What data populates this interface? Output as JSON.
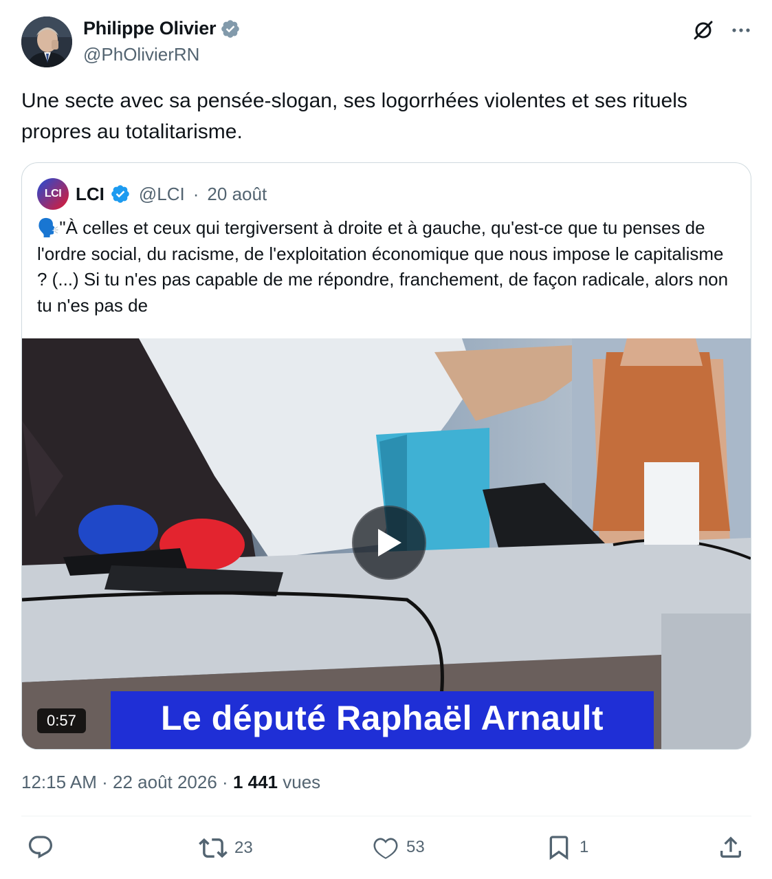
{
  "author": {
    "display_name": "Philippe Olivier",
    "handle": "@PhOlivierRN",
    "verified": true
  },
  "icons": {
    "grok": "grok-icon",
    "more": "more-icon",
    "verified": "verified-badge-icon",
    "reply": "reply-icon",
    "retweet": "retweet-icon",
    "like": "heart-icon",
    "bookmark": "bookmark-icon",
    "share": "share-icon",
    "play": "play-icon"
  },
  "tweet": {
    "text": "Une secte avec sa pensée-slogan, ses logorrhées violentes et ses rituels propres au totalitarisme."
  },
  "quoted": {
    "logo_text": "LCI",
    "name": "LCI",
    "handle": "@LCI",
    "separator": "·",
    "date": "20 août",
    "emoji": "🗣️",
    "text": "\"À celles et ceux qui tergiversent à droite et à gauche, qu'est-ce que tu penses de l'ordre social, du racisme, de l'exploitation économique que nous impose le capitalisme ? (...) Si tu n'es pas capable de me répondre, franchement, de façon radicale, alors non tu n'es pas de",
    "video": {
      "duration": "0:57",
      "caption": "Le député Raphaël Arnault"
    }
  },
  "meta": {
    "time": "12:15 AM",
    "sep1": "·",
    "date": "22 août 2026",
    "sep2": "·",
    "views_count": "1 441",
    "views_label": "vues"
  },
  "stats": {
    "reposts": "23",
    "likes": "53",
    "bookmarks": "1"
  },
  "colors": {
    "text": "#0f1419",
    "secondary": "#536471",
    "verified": "#1d9bf0",
    "border": "#cfd9de",
    "caption_bg": "#1f2fd6"
  }
}
